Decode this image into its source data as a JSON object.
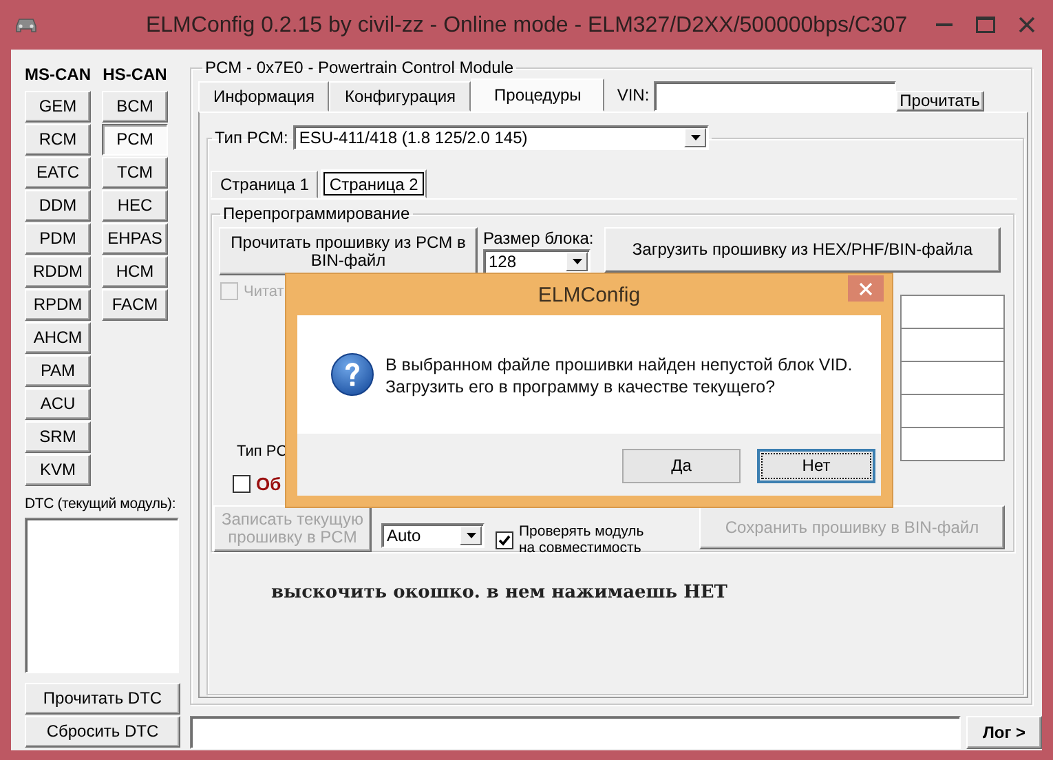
{
  "window": {
    "title": "ELMConfig 0.2.15 by civil-zz - Online mode - ELM327/D2XX/500000bps/C307"
  },
  "bus_headers": [
    "MS-CAN",
    "HS-CAN"
  ],
  "modules": {
    "ms_can": [
      {
        "label": "GEM",
        "selected": false
      },
      {
        "label": "RCM",
        "selected": false
      },
      {
        "label": "EATC",
        "selected": false
      },
      {
        "label": "DDM",
        "selected": false
      },
      {
        "label": "PDM",
        "selected": false
      },
      {
        "label": "RDDM",
        "selected": false
      },
      {
        "label": "RPDM",
        "selected": false
      },
      {
        "label": "AHCM",
        "selected": false
      },
      {
        "label": "PAM",
        "selected": false
      },
      {
        "label": "ACU",
        "selected": false
      },
      {
        "label": "SRM",
        "selected": false
      },
      {
        "label": "KVM",
        "selected": false
      }
    ],
    "hs_can": [
      {
        "label": "BCM",
        "selected": false
      },
      {
        "label": "PCM",
        "selected": true
      },
      {
        "label": "TCM",
        "selected": false
      },
      {
        "label": "HEC",
        "selected": false
      },
      {
        "label": "EHPAS",
        "selected": false
      },
      {
        "label": "HCM",
        "selected": false
      },
      {
        "label": "FACM",
        "selected": false
      }
    ]
  },
  "dtc": {
    "label": "DTC (текущий модуль):",
    "buttons": [
      "Прочитать DTC",
      "Сбросить DTC"
    ]
  },
  "module_panel": {
    "title": "PCM - 0x7E0 - Powertrain Control Module",
    "tabs": [
      {
        "label": "Информация",
        "selected": false
      },
      {
        "label": "Конфигурация",
        "selected": false
      },
      {
        "label": "Процедуры",
        "selected": true
      }
    ],
    "vin_label": "VIN:",
    "read_button": "Прочитать"
  },
  "pcm_type": {
    "label": "Тип PCM:",
    "value": "ESU-411/418 (1.8 125/2.0 145)"
  },
  "pages": [
    {
      "label": "Страница 1",
      "selected": false
    },
    {
      "label": "Страница 2",
      "selected": true
    }
  ],
  "reprogramming": {
    "title": "Перепрограммирование",
    "read_button": {
      "label": "Прочитать прошивку из PCM в BIN-файл",
      "disabled": false
    },
    "block_size": {
      "label": "Размер блока:",
      "value": "128"
    },
    "load_button": {
      "label": "Загрузить прошивку из HEX/PHF/BIN-файла",
      "disabled": false
    },
    "read_checkbox": {
      "label": "Читат",
      "checked": false,
      "disabled": true
    },
    "type_label": "Тип PC",
    "warning_checkbox": {
      "label": "Об",
      "checked": false,
      "disabled": false
    },
    "write_button": {
      "label": "Записать текущую прошивку в PCM",
      "disabled": true
    },
    "mode_combo": {
      "value": "Auto"
    },
    "verify_checkbox": {
      "label": "Проверять модуль на совместимость",
      "checked": true,
      "disabled": false
    },
    "save_button": {
      "label": "Сохранить прошивку в BIN-файл",
      "disabled": true
    }
  },
  "annotation": "выскочить окошко. в нем нажимаешь НЕТ",
  "log_button": "Лог >",
  "dialog": {
    "title": "ELMConfig",
    "message": [
      "В выбранном файле прошивки найден непустой блок VID.",
      "Загрузить его в программу в качестве текущего?"
    ],
    "buttons": [
      {
        "label": "Да",
        "focused": false
      },
      {
        "label": "Нет",
        "focused": true
      }
    ]
  }
}
